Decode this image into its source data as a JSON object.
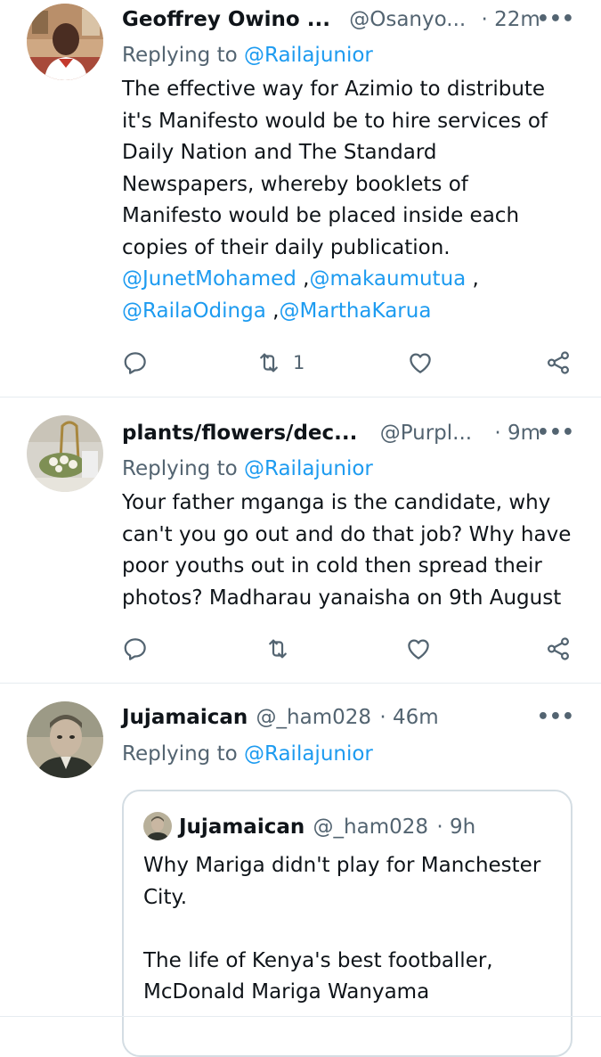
{
  "tweets": [
    {
      "name": "Geoffrey Owino ...",
      "handle": "@Osanyo...",
      "time": "· 22m",
      "more": "•••",
      "replying_prefix": "Replying to ",
      "replying_to": "@Railajunior",
      "lines": [
        "The effective way for Azimio to distribute",
        "it's Manifesto would be to hire services of",
        "Daily Nation and The Standard",
        "Newspapers, whereby booklets of",
        "Manifesto would be placed inside each",
        "copies of their daily publication."
      ],
      "mentions_line1": [
        "@JunetMohamed",
        " ,",
        "@makaumutua",
        " ,"
      ],
      "mentions_line2": [
        "@RailaOdinga",
        " ,",
        "@MarthaKarua"
      ],
      "retweet_count": "1",
      "avatar_icon": "person-photo"
    },
    {
      "name": "plants/flowers/dec...",
      "handle": "@Purpl...",
      "time": "· 9m",
      "more": "•••",
      "replying_prefix": "Replying to ",
      "replying_to": "@Railajunior",
      "lines": [
        "Your father mganga is the candidate, why",
        "can't you go out and do that job? Why have",
        "poor youths out in cold then spread their",
        "photos? Madharau yanaisha on 9th August"
      ],
      "retweet_count": "",
      "avatar_icon": "flowers-photo"
    },
    {
      "name": "Jujamaican",
      "handle": "@_ham028",
      "time": "· 46m",
      "more": "•••",
      "replying_prefix": "Replying to ",
      "replying_to": "@Railajunior",
      "avatar_icon": "portrait-photo"
    }
  ],
  "quote": {
    "name": "Jujamaican",
    "handle": "@_ham028",
    "time": "· 9h",
    "lines": [
      "Why Mariga didn't play for Manchester",
      "City.",
      "",
      "The life of Kenya's best footballer,",
      "McDonald Mariga Wanyama"
    ]
  },
  "icons": [
    "reply-icon",
    "retweet-icon",
    "like-icon",
    "share-icon",
    "more-icon"
  ],
  "colors": {
    "link": "#1d9bf0",
    "secondary": "#536471",
    "text": "#0f1419",
    "divider": "#e6ecf0"
  }
}
